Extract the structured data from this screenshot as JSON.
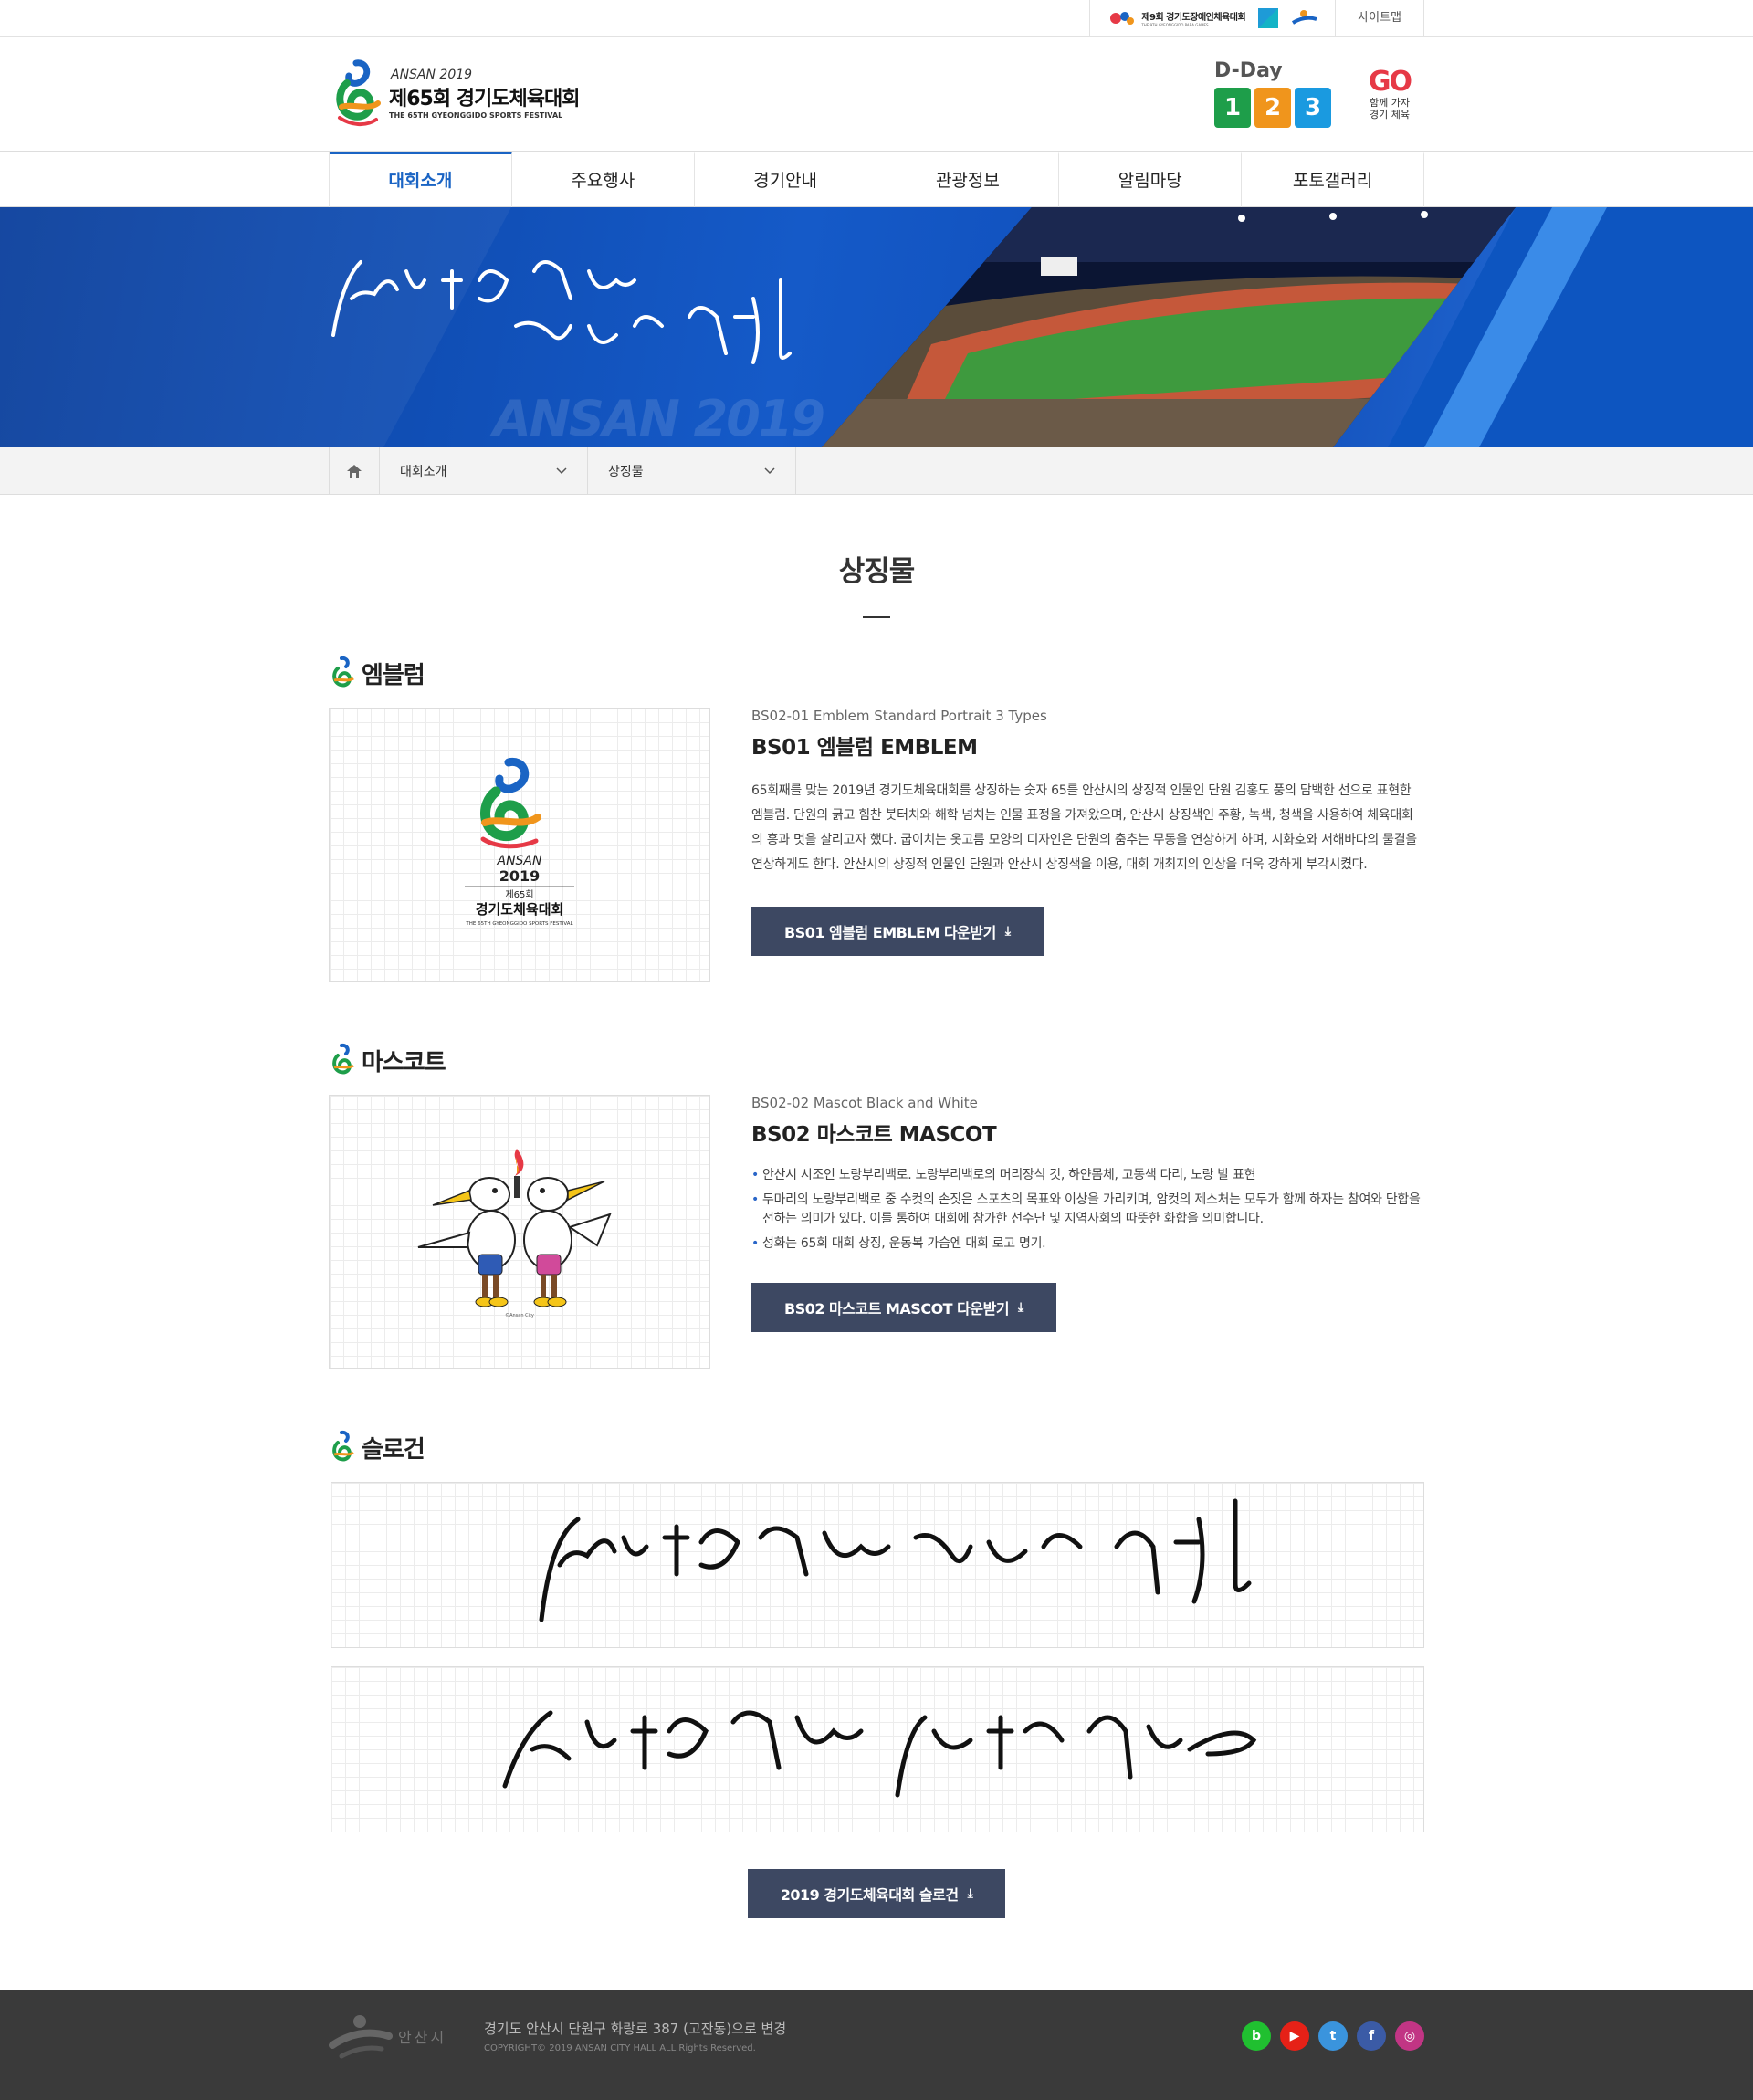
{
  "topbar": {
    "para_games_title": "제9회 경기도장애인체육대회",
    "para_games_sub": "THE 9TH GYEONGGIDO PARA GAMES",
    "sitemap_label": "사이트맵"
  },
  "header": {
    "brand_ansan": "ANSAN 2019",
    "brand_title": "제65회 경기도체육대회",
    "brand_sub": "THE 65TH GYEONGGIDO SPORTS FESTIVAL",
    "dday_label": "D-Day",
    "dday_digits": [
      "1",
      "2",
      "3"
    ],
    "dday_colors": [
      "#1e9e4a",
      "#f0951c",
      "#1a9ae0"
    ],
    "go_logo_text": "GO",
    "go_logo_sub1": "함께 가자",
    "go_logo_sub2": "경기 체육"
  },
  "gnb": {
    "items": [
      "대회소개",
      "주요행사",
      "경기안내",
      "관광정보",
      "알림마당",
      "포토갤러리"
    ],
    "active_index": 0,
    "accent": "#1a64c4"
  },
  "banner": {
    "ghost_text": "ANSAN 2019"
  },
  "location": {
    "home_icon": "home-icon",
    "depth1": "대회소개",
    "depth2": "상징물"
  },
  "page": {
    "title": "상징물"
  },
  "emblem_section": {
    "heading": "엠블럼",
    "code": "BS02-01 Emblem Standard Portrait 3 Types",
    "name": "BS01 엠블럼 EMBLEM",
    "description": "65회째를 맞는 2019년 경기도체육대회를 상징하는 숫자 65를 안산시의 상징적 인물인 단원 김홍도 풍의 담백한 선으로 표현한 엠블럼. 단원의 굵고 힘찬 붓터치와 해학 넘치는 인물 표정을 가져왔으며, 안산시 상징색인 주황, 녹색, 청색을 사용하여 체육대회의 흥과 멋을 살리고자 했다. 굽이치는 옷고름 모양의 디자인은 단원의 춤추는 무동을 연상하게 하며, 시화호와 서해바다의 물결을 연상하게도 한다. 안산시의 상징적 인물인 단원과 안산시 상징색을 이용, 대회 개최지의 인상을 더욱 강하게 부각시켰다.",
    "image_ansan": "ANSAN",
    "image_year": "2019",
    "image_times": "제65회",
    "image_title": "경기도체육대회",
    "image_sub": "THE 65TH GYEONGGIDO SPORTS FESTIVAL",
    "download_label": "BS01 엠블럼 EMBLEM 다운받기"
  },
  "mascot_section": {
    "heading": "마스코트",
    "code": "BS02-02 Mascot Black and White",
    "name": "BS02 마스코트 MASCOT",
    "bullets": [
      "안산시 시조인 노랑부리백로. 노랑부리백로의 머리장식 깃, 하얀몸체, 고동색 다리, 노랑 발 표현",
      "두마리의 노랑부리백로 중 수컷의 손짓은 스포츠의 목표와 이상을 가리키며, 암컷의 제스처는 모두가 함께 하자는 참여와 단합을 전하는 의미가 있다. 이를 통하여 대회에 참가한 선수단 및 지역사회의 따뜻한 화합을 의미합니다.",
      "성화는 65회 대회 상징, 운동복 가슴엔 대회 로고 명기."
    ],
    "image_caption": "©Ansan City",
    "download_label": "BS02 마스코트 MASCOT 다운받기"
  },
  "slogan_section": {
    "heading": "슬로건",
    "download_label": "2019 경기도체육대회 슬로건"
  },
  "footer": {
    "logo_text": "안산시",
    "address": "경기도 안산시 단원구 화랑로 387 (고잔동)으로 변경",
    "copyright": "COPYRIGHT© 2019 ANSAN CITY HALL ALL Rights Reserved.",
    "sns": [
      {
        "icon": "blog-icon",
        "glyph": "b",
        "color": "#20c030"
      },
      {
        "icon": "youtube-icon",
        "glyph": "▶",
        "color": "#e62117"
      },
      {
        "icon": "twitter-icon",
        "glyph": "t",
        "color": "#3a94dd"
      },
      {
        "icon": "facebook-icon",
        "glyph": "f",
        "color": "#3b5ba6"
      },
      {
        "icon": "instagram-icon",
        "glyph": "◎",
        "color": "#c13584"
      }
    ]
  }
}
